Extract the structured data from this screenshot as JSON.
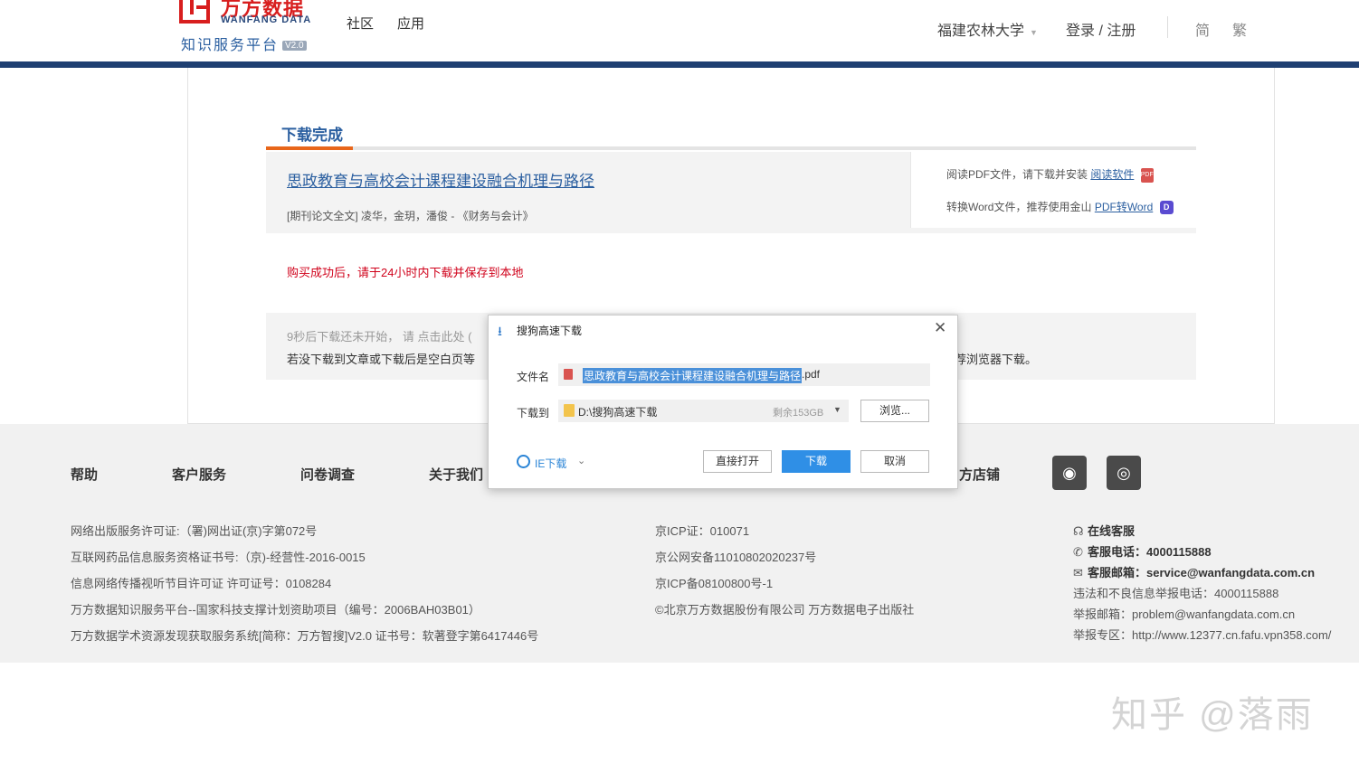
{
  "header": {
    "logo_cn": "万方数据",
    "logo_en": "WANFANG DATA",
    "logo_sub": "知识服务平台",
    "logo_version": "V2.0",
    "nav": [
      "社区",
      "应用"
    ],
    "institution": "福建农林大学",
    "login": "登录 / 注册",
    "lang_simple": "简",
    "lang_trad": "繁"
  },
  "main": {
    "tab_label": "下载完成",
    "paper_title": "思政教育与高校会计课程建设融合机理与路径",
    "paper_meta": "[期刊论文全文] 凌华，金玥，潘俊 - 《财务与会计》",
    "pdf_hint": "阅读PDF文件，请下载并安装",
    "pdf_link": "阅读软件",
    "word_hint": "转换Word文件，推荐使用金山",
    "word_link": "PDF转Word",
    "notice": "购买成功后，请于24小时内下载并保存到本地",
    "tip1": "9秒后下载还未开始， 请 点击此处 (",
    "tip2": "若没下载到文章或下载后是空白页等",
    "tip2_end": "荐浏览器下载。"
  },
  "footer": {
    "nav": [
      "帮助",
      "客户服务",
      "问卷调查",
      "关于我们",
      "方店铺"
    ],
    "left_lines": [
      "网络出版服务许可证:（署)网出证(京)字第072号",
      "互联网药品信息服务资格证书号:（京)-经营性-2016-0015",
      "信息网络传播视听节目许可证 许可证号：0108284",
      "万方数据知识服务平台--国家科技支撑计划资助项目（编号：2006BAH03B01）",
      "万方数据学术资源发现获取服务系统[简称：万方智搜]V2.0 证书号：软著登字第6417446号"
    ],
    "mid_lines": [
      "京ICP证：010071",
      "京公网安备11010802020237号",
      "京ICP备08100800号-1",
      "©北京万方数据股份有限公司 万方数据电子出版社"
    ],
    "service_title": "在线客服",
    "phone_label": "客服电话：",
    "phone": "4000115888",
    "email_label": "客服邮箱：",
    "email": "service@wanfangdata.com.cn",
    "report_phone": "违法和不良信息举报电话：4000115888",
    "report_email": "举报邮箱：problem@wanfangdata.com.cn",
    "report_zone": "举报专区：http://www.12377.cn.fafu.vpn358.com/"
  },
  "dialog": {
    "title": "搜狗高速下载",
    "file_label": "文件名",
    "file_name": "思政教育与高校会计课程建设融合机理与路径",
    "file_ext": ".pdf",
    "path_label": "下载到",
    "path": "D:\\搜狗高速下载",
    "free_space": "剩余153GB",
    "browse": "浏览...",
    "ie_download": "IE下载",
    "open_direct": "直接打开",
    "download": "下载",
    "cancel": "取消"
  },
  "watermark": "知乎 @落雨",
  "icons": {
    "weibo": "weibo-icon",
    "wechat": "wechat-icon",
    "headset": "headset-icon",
    "phone": "phone-icon",
    "mail": "mail-icon",
    "download": "download-icon",
    "close": "close-icon"
  },
  "colors": {
    "brand_red": "#d81e1e",
    "brand_blue": "#1f3f72",
    "accent_orange": "#e8661a",
    "link_blue": "#2b5fa0",
    "primary_button": "#2f8fe6",
    "notice_red": "#d0021b"
  }
}
